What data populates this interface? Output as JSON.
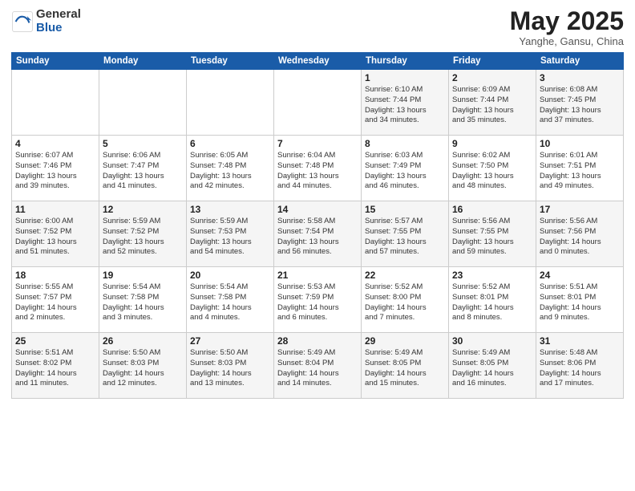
{
  "logo": {
    "general": "General",
    "blue": "Blue"
  },
  "header": {
    "month": "May 2025",
    "location": "Yanghe, Gansu, China"
  },
  "days_of_week": [
    "Sunday",
    "Monday",
    "Tuesday",
    "Wednesday",
    "Thursday",
    "Friday",
    "Saturday"
  ],
  "weeks": [
    [
      {
        "day": "",
        "info": ""
      },
      {
        "day": "",
        "info": ""
      },
      {
        "day": "",
        "info": ""
      },
      {
        "day": "",
        "info": ""
      },
      {
        "day": "1",
        "info": "Sunrise: 6:10 AM\nSunset: 7:44 PM\nDaylight: 13 hours\nand 34 minutes."
      },
      {
        "day": "2",
        "info": "Sunrise: 6:09 AM\nSunset: 7:44 PM\nDaylight: 13 hours\nand 35 minutes."
      },
      {
        "day": "3",
        "info": "Sunrise: 6:08 AM\nSunset: 7:45 PM\nDaylight: 13 hours\nand 37 minutes."
      }
    ],
    [
      {
        "day": "4",
        "info": "Sunrise: 6:07 AM\nSunset: 7:46 PM\nDaylight: 13 hours\nand 39 minutes."
      },
      {
        "day": "5",
        "info": "Sunrise: 6:06 AM\nSunset: 7:47 PM\nDaylight: 13 hours\nand 41 minutes."
      },
      {
        "day": "6",
        "info": "Sunrise: 6:05 AM\nSunset: 7:48 PM\nDaylight: 13 hours\nand 42 minutes."
      },
      {
        "day": "7",
        "info": "Sunrise: 6:04 AM\nSunset: 7:48 PM\nDaylight: 13 hours\nand 44 minutes."
      },
      {
        "day": "8",
        "info": "Sunrise: 6:03 AM\nSunset: 7:49 PM\nDaylight: 13 hours\nand 46 minutes."
      },
      {
        "day": "9",
        "info": "Sunrise: 6:02 AM\nSunset: 7:50 PM\nDaylight: 13 hours\nand 48 minutes."
      },
      {
        "day": "10",
        "info": "Sunrise: 6:01 AM\nSunset: 7:51 PM\nDaylight: 13 hours\nand 49 minutes."
      }
    ],
    [
      {
        "day": "11",
        "info": "Sunrise: 6:00 AM\nSunset: 7:52 PM\nDaylight: 13 hours\nand 51 minutes."
      },
      {
        "day": "12",
        "info": "Sunrise: 5:59 AM\nSunset: 7:52 PM\nDaylight: 13 hours\nand 52 minutes."
      },
      {
        "day": "13",
        "info": "Sunrise: 5:59 AM\nSunset: 7:53 PM\nDaylight: 13 hours\nand 54 minutes."
      },
      {
        "day": "14",
        "info": "Sunrise: 5:58 AM\nSunset: 7:54 PM\nDaylight: 13 hours\nand 56 minutes."
      },
      {
        "day": "15",
        "info": "Sunrise: 5:57 AM\nSunset: 7:55 PM\nDaylight: 13 hours\nand 57 minutes."
      },
      {
        "day": "16",
        "info": "Sunrise: 5:56 AM\nSunset: 7:55 PM\nDaylight: 13 hours\nand 59 minutes."
      },
      {
        "day": "17",
        "info": "Sunrise: 5:56 AM\nSunset: 7:56 PM\nDaylight: 14 hours\nand 0 minutes."
      }
    ],
    [
      {
        "day": "18",
        "info": "Sunrise: 5:55 AM\nSunset: 7:57 PM\nDaylight: 14 hours\nand 2 minutes."
      },
      {
        "day": "19",
        "info": "Sunrise: 5:54 AM\nSunset: 7:58 PM\nDaylight: 14 hours\nand 3 minutes."
      },
      {
        "day": "20",
        "info": "Sunrise: 5:54 AM\nSunset: 7:58 PM\nDaylight: 14 hours\nand 4 minutes."
      },
      {
        "day": "21",
        "info": "Sunrise: 5:53 AM\nSunset: 7:59 PM\nDaylight: 14 hours\nand 6 minutes."
      },
      {
        "day": "22",
        "info": "Sunrise: 5:52 AM\nSunset: 8:00 PM\nDaylight: 14 hours\nand 7 minutes."
      },
      {
        "day": "23",
        "info": "Sunrise: 5:52 AM\nSunset: 8:01 PM\nDaylight: 14 hours\nand 8 minutes."
      },
      {
        "day": "24",
        "info": "Sunrise: 5:51 AM\nSunset: 8:01 PM\nDaylight: 14 hours\nand 9 minutes."
      }
    ],
    [
      {
        "day": "25",
        "info": "Sunrise: 5:51 AM\nSunset: 8:02 PM\nDaylight: 14 hours\nand 11 minutes."
      },
      {
        "day": "26",
        "info": "Sunrise: 5:50 AM\nSunset: 8:03 PM\nDaylight: 14 hours\nand 12 minutes."
      },
      {
        "day": "27",
        "info": "Sunrise: 5:50 AM\nSunset: 8:03 PM\nDaylight: 14 hours\nand 13 minutes."
      },
      {
        "day": "28",
        "info": "Sunrise: 5:49 AM\nSunset: 8:04 PM\nDaylight: 14 hours\nand 14 minutes."
      },
      {
        "day": "29",
        "info": "Sunrise: 5:49 AM\nSunset: 8:05 PM\nDaylight: 14 hours\nand 15 minutes."
      },
      {
        "day": "30",
        "info": "Sunrise: 5:49 AM\nSunset: 8:05 PM\nDaylight: 14 hours\nand 16 minutes."
      },
      {
        "day": "31",
        "info": "Sunrise: 5:48 AM\nSunset: 8:06 PM\nDaylight: 14 hours\nand 17 minutes."
      }
    ]
  ]
}
